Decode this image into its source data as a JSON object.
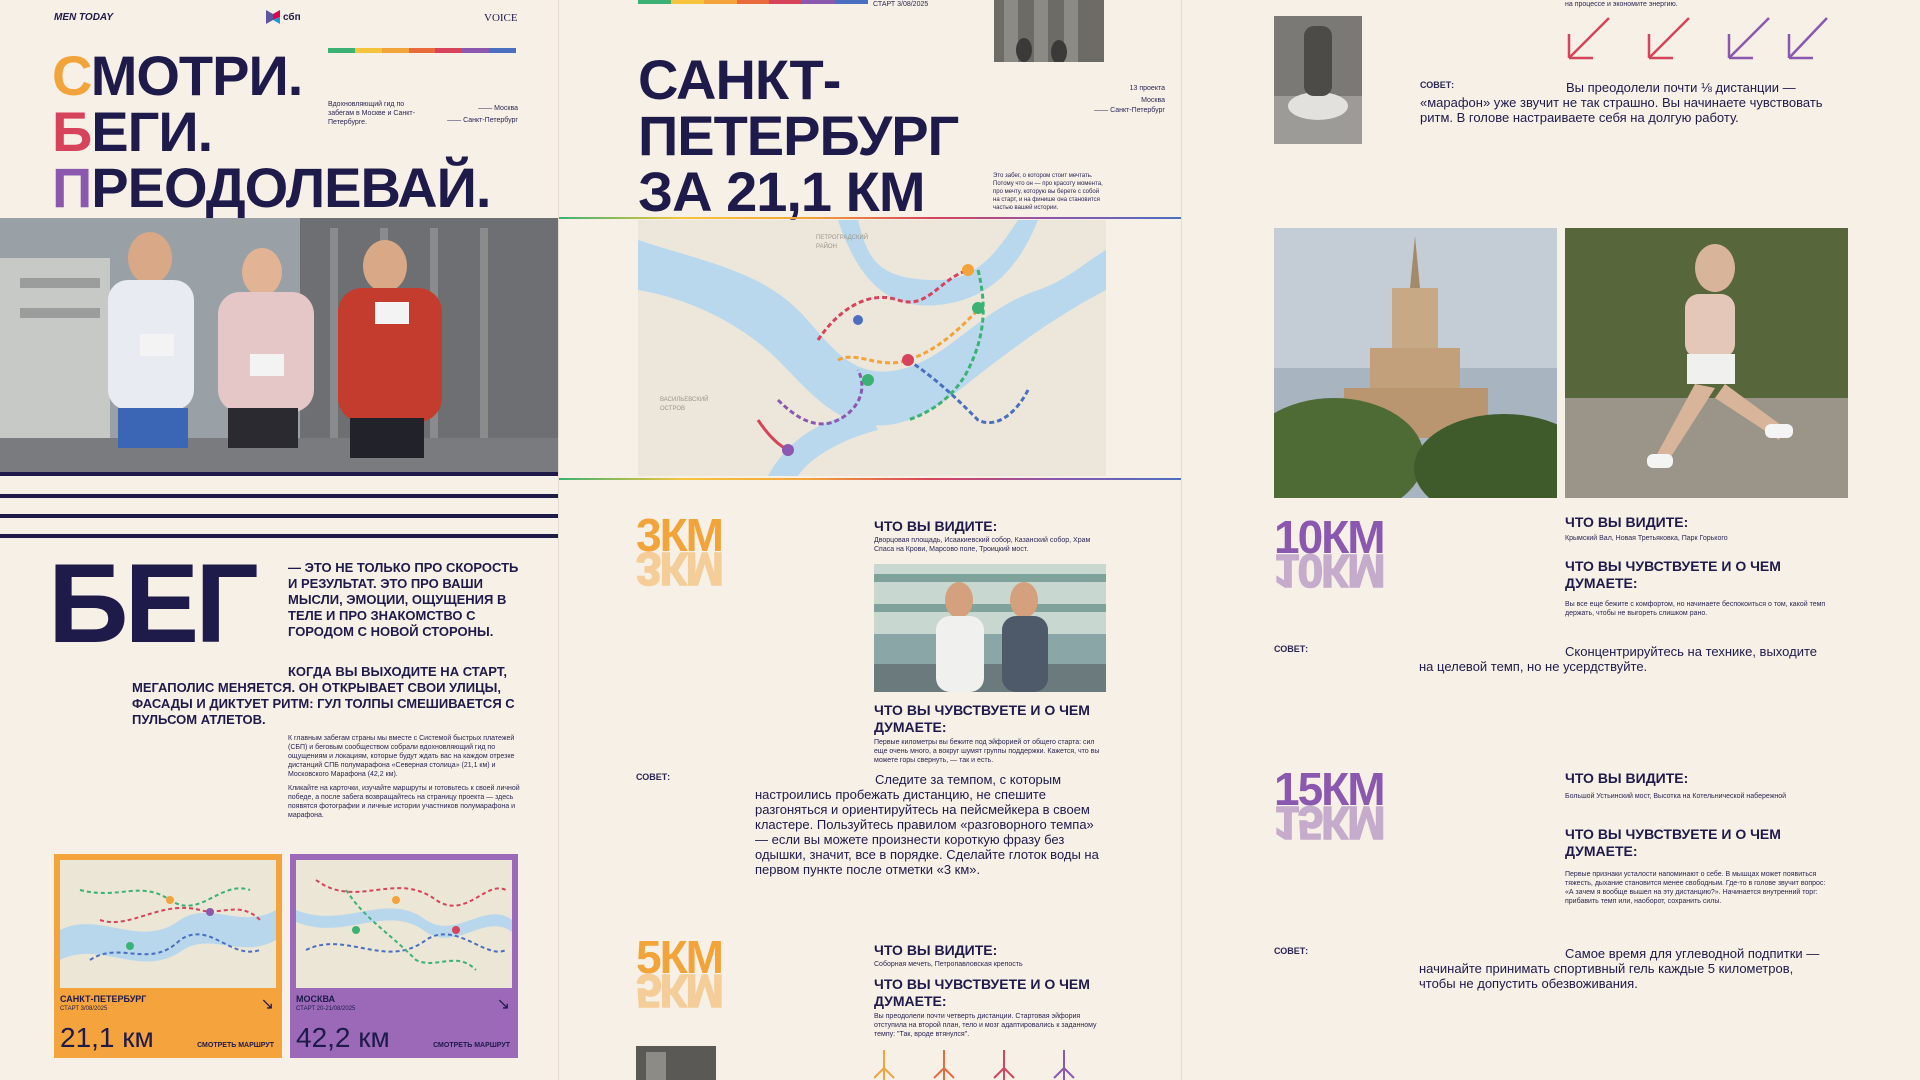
{
  "colors": {
    "navy": "#1e1a4a",
    "orange": "#f2a33a",
    "red": "#d6435b",
    "purple": "#8a58ae",
    "cream": "#f6f0e6"
  },
  "col1": {
    "brand_left": "MEN TODAY",
    "brand_center": "сбп",
    "brand_right": "VOICE",
    "headline_line1_first": "С",
    "headline_line1_rest": "МОТРИ.",
    "headline_line2_first": "Б",
    "headline_line2_rest": "ЕГИ.",
    "headline_line3_first": "П",
    "headline_line3_rest": "РЕОДОЛЕВАЙ.",
    "subtitle": "Вдохновляющий гид по забегам в Москве и Санкт-Петербурге.",
    "city_moscow": "—— Москва",
    "city_spb": "—— Санкт-Петербург",
    "big_word": "БЕГ",
    "intro_caps": "— ЭТО НЕ ТОЛЬКО ПРО СКОРОСТЬ И РЕЗУЛЬТАТ. ЭТО ПРО ВАШИ МЫСЛИ, ЭМОЦИИ, ОЩУЩЕНИЯ В ТЕЛЕ И ПРО ЗНАКОМСТВО С ГОРОДОМ С НОВОЙ СТОРОНЫ.",
    "intro_caps2": "КОГДА ВЫ ВЫХОДИТЕ НА СТАРТ, МЕГАПОЛИС МЕНЯЕТСЯ. ОН ОТКРЫВАЕТ СВОИ УЛИЦЫ, ФАСАДЫ И ДИКТУЕТ РИТМ: ГУЛ ТОЛПЫ СМЕШИВАЕТСЯ С ПУЛЬСОМ АТЛЕТОВ.",
    "small_para1": "К главным забегам страны мы вместе с Системой быстрых платежей (СБП) и беговым сообществом собрали вдохновляющий гид по ощущениям и локациям, которые будут ждать вас на каждом отрезке дистанций СПБ полумарафона «Северная столица» (21,1 км) и Московского Марафона (42,2 км).",
    "small_para2": "Кликайте на карточки, изучайте маршруты и готовьтесь к своей личной победе, а после забега возвращайтесь на страницу проекта — здесь появятся фотографии и личные истории участников полумарафона и марафона.",
    "cards": [
      {
        "city": "САНКТ-ПЕТЕРБУРГ",
        "date": "СТАРТ 3/08/2025",
        "distance": "21,1 км",
        "link": "СМОТРЕТЬ МАРШРУТ",
        "bg": "#f5a33c"
      },
      {
        "city": "МОСКВА",
        "date": "СТАРТ 20-21/08/2025",
        "distance": "42,2 км",
        "link": "СМОТРЕТЬ МАРШРУТ",
        "bg": "#9b69b8"
      }
    ]
  },
  "col2": {
    "start_label": "СТАРТ 3/08/2025",
    "title": "САНКТ-ПЕТЕРБУРГ ЗА 21,1 КМ",
    "meta1": "13 проекта",
    "meta2": "Москва",
    "meta3": "—— Санкт-Петербург",
    "side_note": "Это забег, о котором стоит мечтать. Потому что он — про красоту момента, про мечту, которую вы берете с собой на старт, и на финише она становится частью вашей истории.",
    "map_label1": "ПЕТРОГРАДСКИЙ РАЙОН",
    "map_label2": "ВАСИЛЬЕВСКИЙ ОСТРОВ",
    "km3": "3КМ",
    "km3_see_h": "ЧТО ВЫ ВИДИТЕ:",
    "km3_see": "Дворцовая площадь, Исаакиевский собор, Казанский собор, Храм Спаса на Крови, Марсово поле, Троицкий мост.",
    "km3_feel_h": "ЧТО ВЫ ЧУВСТВУЕТЕ И О ЧЕМ ДУМАЕТЕ:",
    "km3_feel": "Первые километры вы бежите под эйфорией от общего старта: сил еще очень много, а вокруг шумят группы поддержки. Кажется, что вы можете горы свернуть, — так и есть.",
    "tip_label": "СОВЕТ:",
    "km3_tip": "Следите за темпом, с которым настроились пробежать дистанцию, не спешите разгоняться и ориентируйтесь на пейсмейкера в своем кластере. Пользуйтесь правилом «разговорного темпа» — если вы можете произнести короткую фразу без одышки, значит, все в порядке. Сделайте глоток воды на первом пункте после отметки «3 км».",
    "km5": "5КМ",
    "km5_see_h": "ЧТО ВЫ ВИДИТЕ:",
    "km5_see": "Соборная мечеть, Петропавловская крепость",
    "km5_feel_h": "ЧТО ВЫ ЧУВСТВУЕТЕ И О ЧЕМ ДУМАЕТЕ:",
    "km5_feel": "Вы преодолели почти четверть дистанции. Стартовая эйфория отступила на второй план, тело и мозг адаптировались к заданному темпу: \"Так, вроде втянулся\"."
  },
  "col3": {
    "top_text": "на процессе и экономите энергию.",
    "tip_label": "СОВЕТ:",
    "top_tip": "Вы преодолели почти ⅛ дистанции — «марафон» уже звучит не так страшно. Вы начинаете чувствовать ритм. В голове настраиваете себя на долгую работу.",
    "km10": "10КМ",
    "km10_see_h": "ЧТО ВЫ ВИДИТЕ:",
    "km10_see": "Крымский Вал, Новая Третьяковка, Парк Горького",
    "km10_feel_h": "ЧТО ВЫ ЧУВСТВУЕТЕ И О ЧЕМ ДУМАЕТЕ:",
    "km10_feel": "Вы все еще бежите с комфортом, но начинаете беспокоиться о том, какой темп держать, чтобы не выгореть слишком рано.",
    "km10_tip": "Сконцентрируйтесь на технике, выходите на целевой темп, но не усердствуйте.",
    "km15": "15КМ",
    "km15_see_h": "ЧТО ВЫ ВИДИТЕ:",
    "km15_see": "Большой Устьинский мост, Высотка на Котельнической набережной",
    "km15_feel_h": "ЧТО ВЫ ЧУВСТВУЕТЕ И О ЧЕМ ДУМАЕТЕ:",
    "km15_feel": "Первые признаки усталости напоминают о себе. В мышцах может появиться тяжесть, дыхание становится менее свободным. Где-то в голове звучит вопрос: «А зачем я вообще вышел на эту дистанцию?». Начинается внутренний торг: прибавить темп или, наоборот, сохранить силы.",
    "km15_tip": "Самое время для углеводной подпитки — начинайте принимать спортивный гель каждые 5 километров, чтобы не допустить обезвоживания."
  }
}
